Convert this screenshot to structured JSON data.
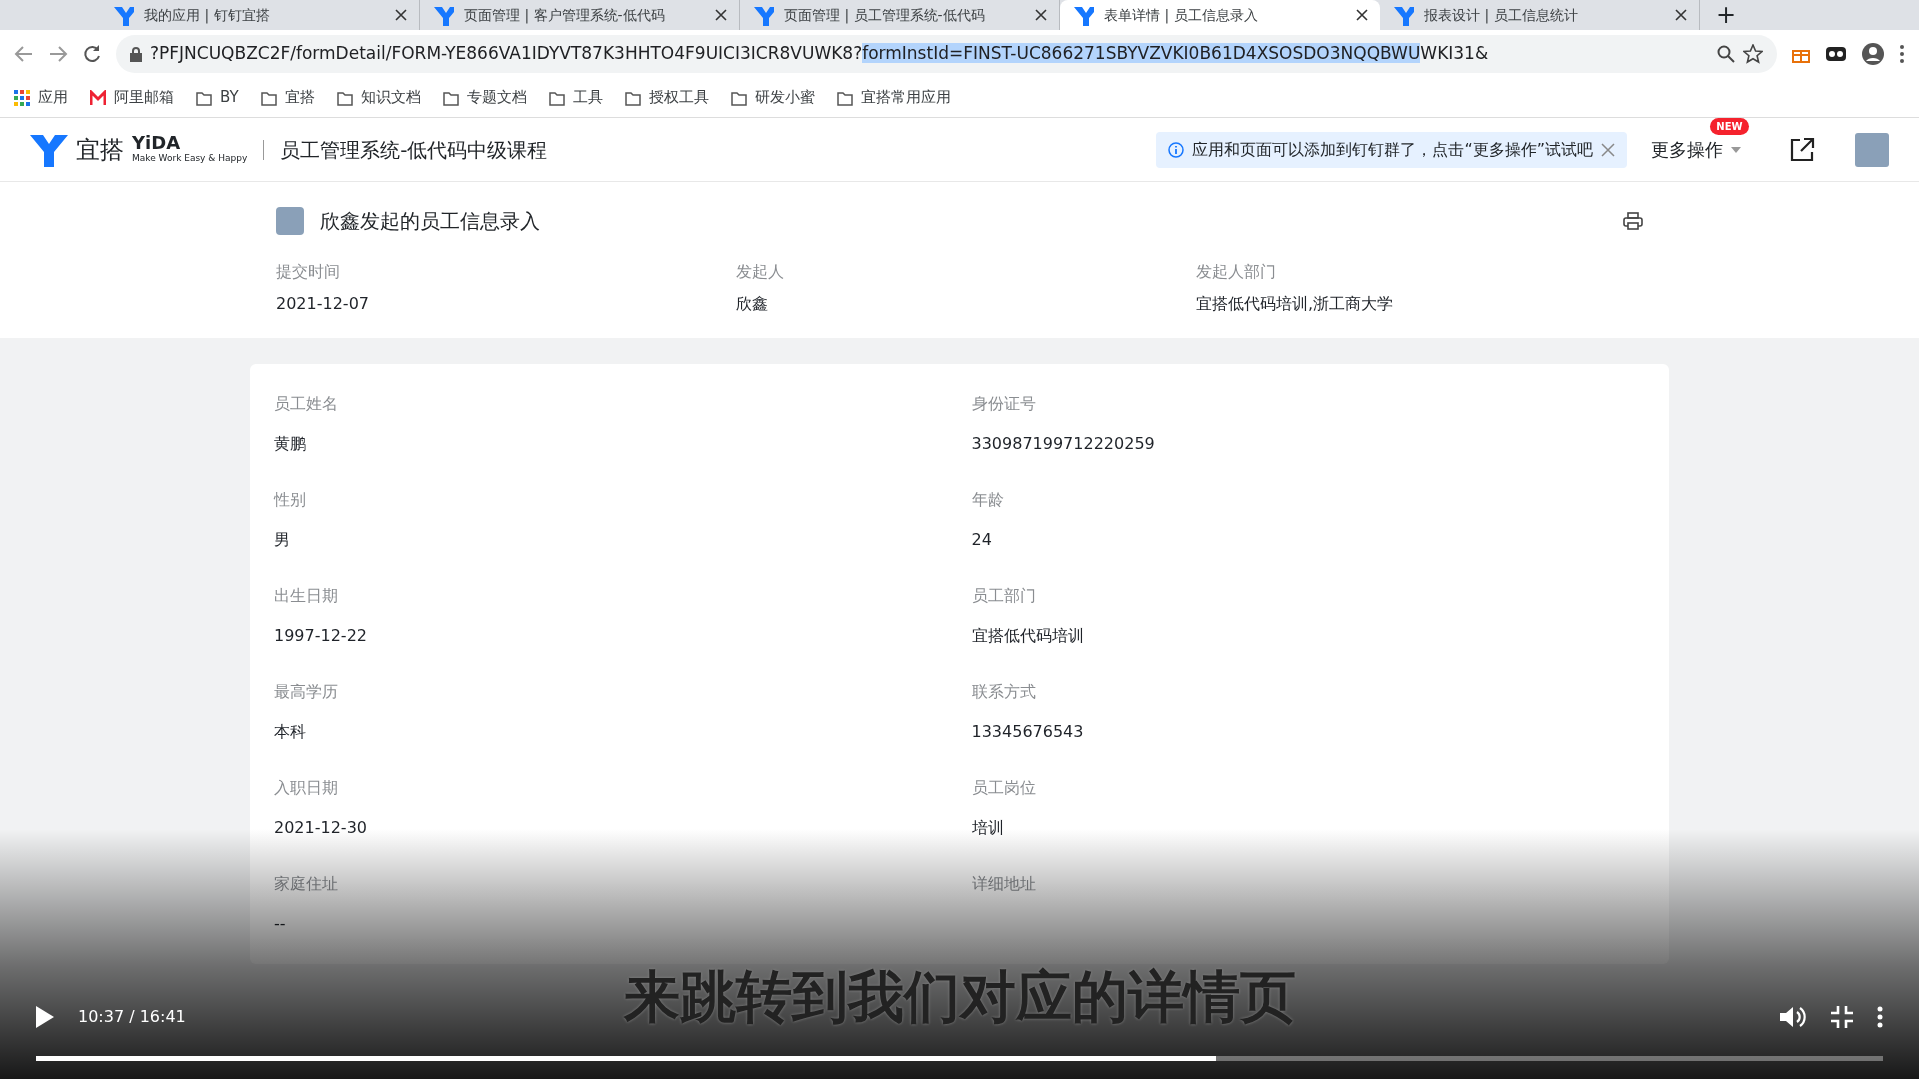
{
  "browser": {
    "tabs": [
      {
        "label": "我的应用 | 钉钉宜搭",
        "selected": false
      },
      {
        "label": "页面管理 | 客户管理系统-低代码",
        "selected": false
      },
      {
        "label": "页面管理 | 员工管理系统-低代码",
        "selected": false
      },
      {
        "label": "表单详情 | 员工信息录入",
        "selected": true
      },
      {
        "label": "报表设计 | 员工信息统计",
        "selected": false
      }
    ],
    "new_tab": "+",
    "url_parts": [
      {
        "text": "?PFJNCUQBZC2F/formDetail/FORM-YE866VA1IDYVT87K3HHTO4F9UICI3ICR8VUWK8?",
        "highlighted": false
      },
      {
        "text": "formInstId=FINST-UC866271SBYVZVKI0B61D4XSOSDO3NQQBWU",
        "highlighted": true
      },
      {
        "text": "WKI31&",
        "highlighted": false
      }
    ],
    "bookmarks": [
      {
        "label": "应用",
        "kind": "apps"
      },
      {
        "label": "阿里邮箱",
        "kind": "mail"
      },
      {
        "label": "BY",
        "kind": "folder"
      },
      {
        "label": "宜搭",
        "kind": "folder"
      },
      {
        "label": "知识文档",
        "kind": "folder"
      },
      {
        "label": "专题文档",
        "kind": "folder"
      },
      {
        "label": "工具",
        "kind": "folder"
      },
      {
        "label": "授权工具",
        "kind": "folder"
      },
      {
        "label": "研发小蜜",
        "kind": "folder"
      },
      {
        "label": "宜搭常用应用",
        "kind": "folder"
      }
    ]
  },
  "app": {
    "logo_text": "宜搭",
    "logo_brand": "YiDA",
    "logo_tagline": "Make Work Easy & Happy",
    "title": "员工管理系统-低代码中级课程",
    "notice": "应用和页面可以添加到钉钉群了，点击“更多操作”试试吧",
    "more_actions": "更多操作",
    "new_badge": "NEW"
  },
  "form_header": {
    "title": "欣鑫发起的员工信息录入",
    "meta": [
      {
        "label": "提交时间",
        "value": "2021-12-07"
      },
      {
        "label": "发起人",
        "value": "欣鑫"
      },
      {
        "label": "发起人部门",
        "value": "宜搭低代码培训,浙工商大学"
      }
    ]
  },
  "fields": [
    {
      "label": "员工姓名",
      "value": "黄鹏"
    },
    {
      "label": "身份证号",
      "value": "330987199712220259"
    },
    {
      "label": "性别",
      "value": "男"
    },
    {
      "label": "年龄",
      "value": "24"
    },
    {
      "label": "出生日期",
      "value": "1997-12-22"
    },
    {
      "label": "员工部门",
      "value": "宜搭低代码培训"
    },
    {
      "label": "最高学历",
      "value": "本科"
    },
    {
      "label": "联系方式",
      "value": "13345676543"
    },
    {
      "label": "入职日期",
      "value": "2021-12-30"
    },
    {
      "label": "员工岗位",
      "value": "培训"
    },
    {
      "label": "家庭住址",
      "value": "--"
    },
    {
      "label": "详细地址"
    }
  ],
  "video": {
    "subtitle": "来跳转到我们对应的详情页",
    "time": "10:37 / 16:41",
    "progress": {
      "level": 0.639
    }
  }
}
